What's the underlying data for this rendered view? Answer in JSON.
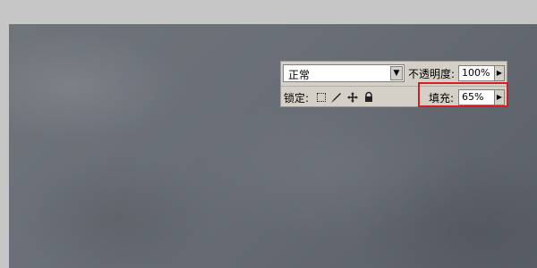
{
  "panel": {
    "blend_mode": "正常",
    "opacity_label": "不透明度:",
    "opacity_value": "100%",
    "lock_label": "锁定:",
    "fill_label": "填充:",
    "fill_value": "65%"
  },
  "colors": {
    "highlight": "#d61e22"
  },
  "icons": {
    "lock_transparent": "checker-square-icon",
    "lock_image": "brush-icon",
    "lock_position": "move-arrows-icon",
    "lock_all": "padlock-icon",
    "dropdown": "triangle-down-icon",
    "stepper": "triangle-right-icon"
  }
}
